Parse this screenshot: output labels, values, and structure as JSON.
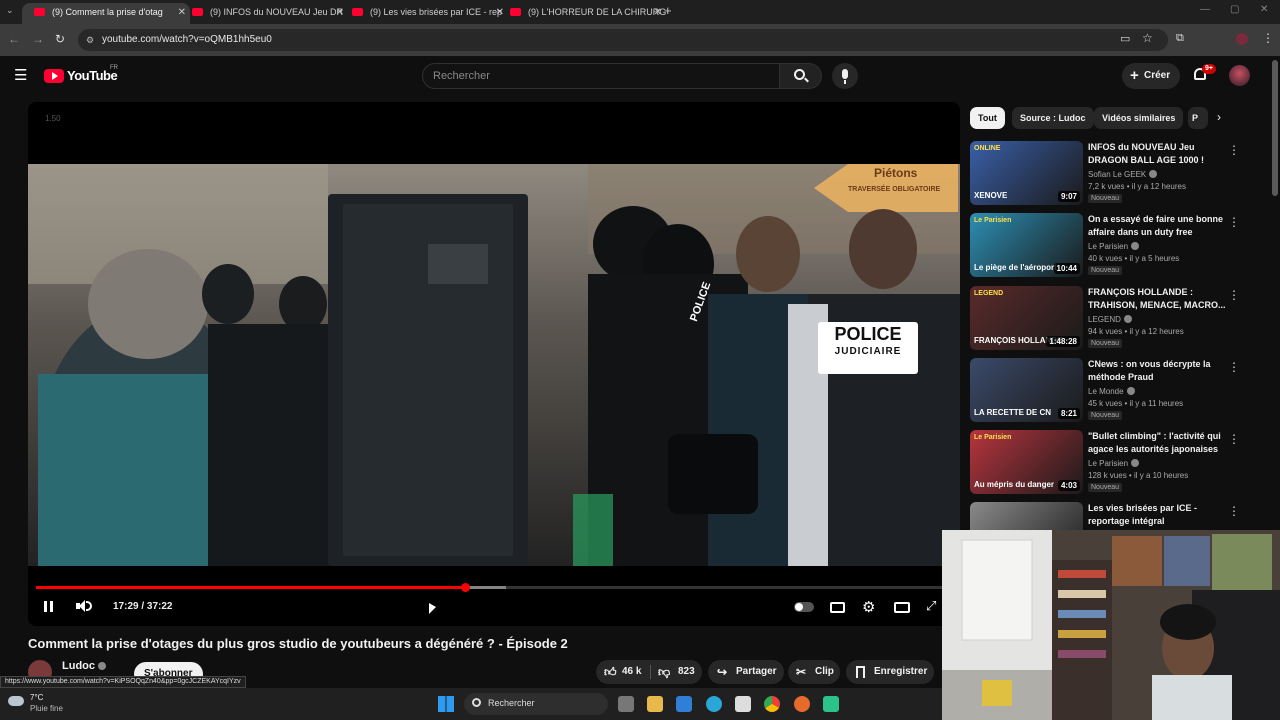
{
  "browser": {
    "tabs": [
      {
        "label": "(9) Comment la prise d'otag",
        "active": true
      },
      {
        "label": "(9) INFOS du NOUVEAU Jeu DR",
        "active": false
      },
      {
        "label": "(9) Les vies brisées par ICE - rep",
        "active": false
      },
      {
        "label": "(9) L'HORREUR DE LA CHIRURG",
        "active": false
      }
    ],
    "new_tab_label": "+",
    "url": "youtube.com/watch?v=oQMB1hh5eu0"
  },
  "youtube": {
    "logo": "YouTube",
    "region": "FR",
    "search_placeholder": "Rechercher",
    "create_label": "Créer",
    "notif_count": "9+"
  },
  "player": {
    "speed_overlay": "1.50",
    "time": "17:29 / 37:22",
    "progress": 0.468,
    "buffered": 0.513,
    "scene_text": {
      "sign_line1": "Piétons",
      "sign_line2": "TRAVERSÉE OBLIGATOIRE",
      "police1": "POLICE",
      "police2": "JUDICIAIRE",
      "police_vest": "POLICE"
    }
  },
  "video": {
    "title": "Comment la prise d'otages du plus gros studio de youtubeurs a dégénéré ? - Épisode 2",
    "channel": "Ludoc",
    "subscribe_label": "S'abonner",
    "likes": "46 k",
    "dislikes": "823",
    "share_label": "Partager",
    "clip_label": "Clip",
    "save_label": "Enregistrer"
  },
  "sidebar": {
    "chips": [
      "Tout",
      "Source : Ludoc",
      "Vidéos similaires",
      "P"
    ],
    "items": [
      {
        "title": "INFOS du NOUVEAU Jeu DRAGON BALL AGE 1000 !",
        "channel": "Sofian Le GEEK",
        "meta": "7,2 k vues • il y a 12 heures",
        "badge": "Nouveau",
        "duration": "9:07",
        "thumb_text": "XENOVE",
        "thumb_sub": "ONLINE",
        "thumb_color": "#3a5fa8"
      },
      {
        "title": "On a essayé de faire une bonne affaire dans un duty free",
        "channel": "Le Parisien",
        "meta": "40 k vues • il y a 5 heures",
        "badge": "Nouveau",
        "duration": "10:44",
        "thumb_text": "Le piège de l'aéroport",
        "thumb_sub": "Le Parisien",
        "thumb_color": "#2c8fb4"
      },
      {
        "title": "FRANÇOIS HOLLANDE : TRAHISON, MENACE, MACRO...",
        "channel": "LEGEND",
        "meta": "94 k vues • il y a 12 heures",
        "badge": "Nouveau",
        "duration": "1:48:28",
        "thumb_text": "FRANÇOIS HOLLANDE",
        "thumb_sub": "LEGEND",
        "thumb_color": "#5a2a2a"
      },
      {
        "title": "CNews : on vous décrypte la méthode Praud",
        "channel": "Le Monde",
        "meta": "45 k vues • il y a 11 heures",
        "badge": "Nouveau",
        "duration": "8:21",
        "thumb_text": "LA RECETTE DE CN",
        "thumb_sub": "",
        "thumb_color": "#3b4a6a"
      },
      {
        "title": "\"Bullet climbing\" : l'activité qui agace les autorités japonaises",
        "channel": "Le Parisien",
        "meta": "128 k vues • il y a 10 heures",
        "badge": "Nouveau",
        "duration": "4:03",
        "thumb_text": "Au mépris du danger",
        "thumb_sub": "Le Parisien",
        "thumb_color": "#b8343e"
      },
      {
        "title": "Les vies brisées par ICE - reportage intégral",
        "channel": "",
        "meta": "",
        "badge": "",
        "duration": "",
        "thumb_text": "",
        "thumb_sub": "",
        "thumb_color": "#8a8a8a"
      }
    ]
  },
  "status_url": "https://www.youtube.com/watch?v=KiPSOQqZn40&pp=0gcJCZEKAYcqIYzv",
  "taskbar": {
    "weather_temp": "7°C",
    "weather_desc": "Pluie fine",
    "search_label": "Rechercher"
  }
}
